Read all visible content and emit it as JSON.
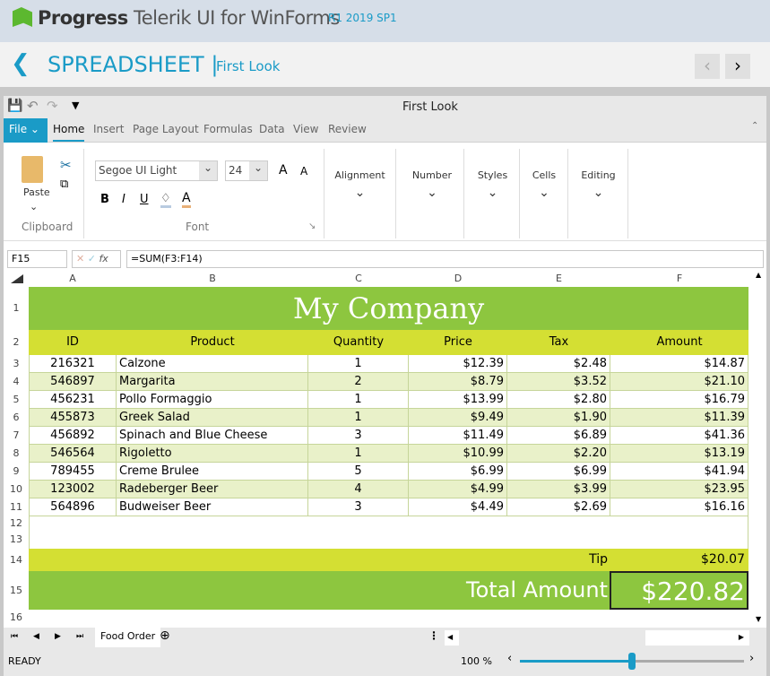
{
  "brand": {
    "company": "Progress",
    "product": "Telerik UI for WinForms",
    "version": "R1 2019 SP1"
  },
  "nav": {
    "back_icon": "chevron-left-icon",
    "title": "SPREADSHEET |",
    "subtitle": "First Look"
  },
  "window": {
    "title": "First Look"
  },
  "ribbon": {
    "file": "File",
    "tabs": [
      "Home",
      "Insert",
      "Page Layout",
      "Formulas",
      "Data",
      "View",
      "Review"
    ],
    "active_tab": "Home",
    "paste": "Paste",
    "clipboard": "Clipboard",
    "font_group": "Font",
    "font_name": "Segoe UI Light",
    "font_size": "24",
    "groups": [
      "Alignment",
      "Number",
      "Styles",
      "Cells",
      "Editing"
    ],
    "bold": "B",
    "italic": "I",
    "underline": "U",
    "font_color": "A",
    "grow": "A",
    "shrink": "A"
  },
  "formula_bar": {
    "name_box": "F15",
    "fx": "fx",
    "formula": "=SUM(F3:F14)"
  },
  "columns": [
    "A",
    "B",
    "C",
    "D",
    "E",
    "F"
  ],
  "rows": [
    "1",
    "2",
    "3",
    "4",
    "5",
    "6",
    "7",
    "8",
    "9",
    "10",
    "11",
    "12",
    "13",
    "14",
    "15",
    "16"
  ],
  "sheet": {
    "title": "My Company",
    "headers": [
      "ID",
      "Product",
      "Quantity",
      "Price",
      "Tax",
      "Amount"
    ],
    "data": [
      [
        "216321",
        "Calzone",
        "1",
        "$12.39",
        "$2.48",
        "$14.87"
      ],
      [
        "546897",
        "Margarita",
        "2",
        "$8.79",
        "$3.52",
        "$21.10"
      ],
      [
        "456231",
        "Pollo Formaggio",
        "1",
        "$13.99",
        "$2.80",
        "$16.79"
      ],
      [
        "455873",
        "Greek Salad",
        "1",
        "$9.49",
        "$1.90",
        "$11.39"
      ],
      [
        "456892",
        "Spinach and Blue Cheese",
        "3",
        "$11.49",
        "$6.89",
        "$41.36"
      ],
      [
        "546564",
        "Rigoletto",
        "1",
        "$10.99",
        "$2.20",
        "$13.19"
      ],
      [
        "789455",
        "Creme Brulee",
        "5",
        "$6.99",
        "$6.99",
        "$41.94"
      ],
      [
        "123002",
        "Radeberger Beer",
        "4",
        "$4.99",
        "$3.99",
        "$23.95"
      ],
      [
        "564896",
        "Budweiser Beer",
        "3",
        "$4.49",
        "$2.69",
        "$16.16"
      ]
    ],
    "tip_label": "Tip",
    "tip_value": "$20.07",
    "total_label": "Total Amount",
    "total_value": "$220.82"
  },
  "colors": {
    "green": "#8dc63f",
    "yellow": "#d4df33",
    "light": "#e9f1c9",
    "accent": "#1a9bc7"
  },
  "sheet_tabs": [
    "Food Order"
  ],
  "status": {
    "text": "READY",
    "zoom": "100 %",
    "zoom_level": 0.5
  }
}
